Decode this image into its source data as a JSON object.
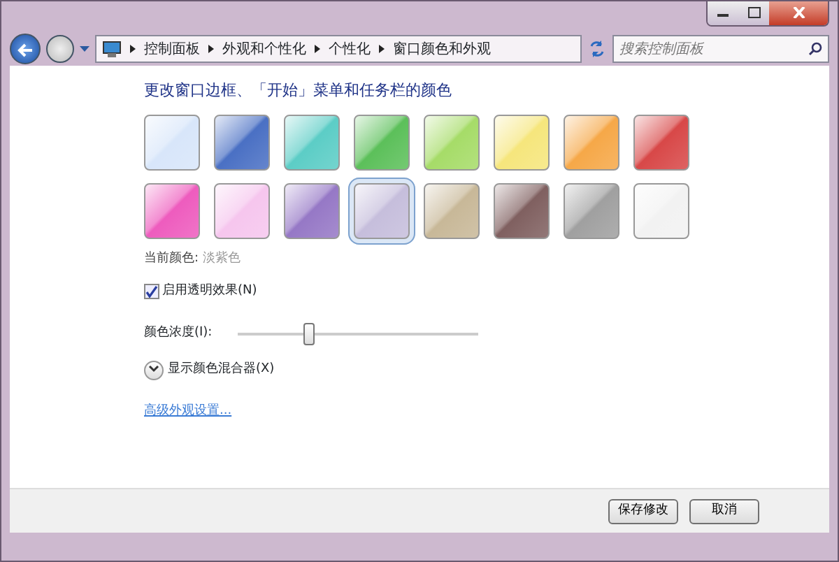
{
  "breadcrumb": [
    "控制面板",
    "外观和个性化",
    "个性化",
    "窗口颜色和外观"
  ],
  "search": {
    "placeholder": "搜索控制面板"
  },
  "heading": "更改窗口边框、「开始」菜单和任务栏的颜色",
  "swatches": [
    {
      "color": "#d8e6fa",
      "selected": false
    },
    {
      "color": "#4a70c4",
      "selected": false
    },
    {
      "color": "#5ccdc6",
      "selected": false
    },
    {
      "color": "#5cc05a",
      "selected": false
    },
    {
      "color": "#a6dc68",
      "selected": false
    },
    {
      "color": "#f6e67c",
      "selected": false
    },
    {
      "color": "#f6a848",
      "selected": false
    },
    {
      "color": "#d84848",
      "selected": false
    },
    {
      "color": "#ee5cbe",
      "selected": false
    },
    {
      "color": "#f6c6ee",
      "selected": false
    },
    {
      "color": "#9678c6",
      "selected": false
    },
    {
      "color": "#c6bedc",
      "selected": true
    },
    {
      "color": "#c8b898",
      "selected": false
    },
    {
      "color": "#806060",
      "selected": false
    },
    {
      "color": "#a0a0a0",
      "selected": false
    },
    {
      "color": "#f2f2f2",
      "selected": false
    }
  ],
  "current_color": {
    "label": "当前颜色:",
    "value": "淡紫色"
  },
  "transparency": {
    "label": "启用透明效果(N)",
    "checked": true
  },
  "intensity": {
    "label": "颜色浓度(I):",
    "level": 0.3
  },
  "mixer": {
    "label": "显示颜色混合器(X)",
    "expanded": false
  },
  "advanced_link": "高级外观设置...",
  "buttons": [
    "保存修改",
    "取消"
  ]
}
